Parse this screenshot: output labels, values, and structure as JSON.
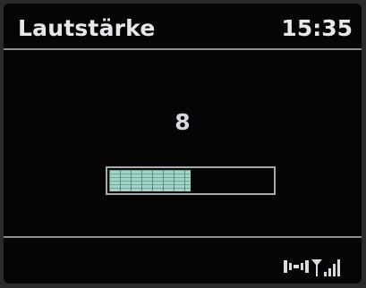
{
  "header": {
    "title": "Lautstärke",
    "clock": "15:35"
  },
  "volume": {
    "value": "8",
    "level": 8,
    "max": 16,
    "fill_color": "#9fd4c6"
  },
  "status_bar": {
    "icons": [
      "network-link-icon",
      "signal-strength-icon"
    ]
  }
}
